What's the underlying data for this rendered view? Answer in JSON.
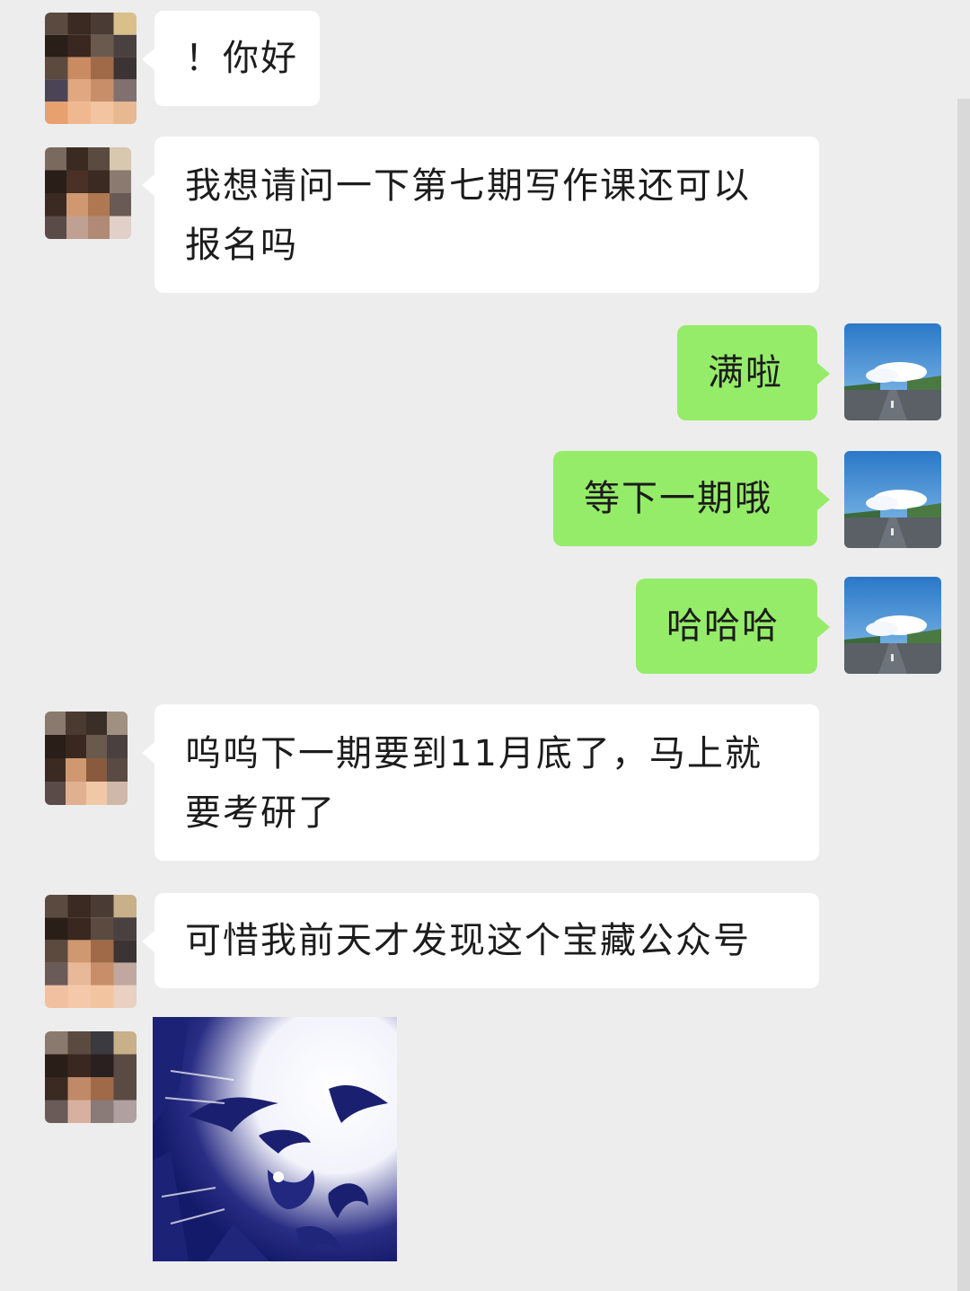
{
  "conversation": {
    "messages": [
      {
        "side": "left",
        "lines": [
          "！你好"
        ]
      },
      {
        "side": "left",
        "lines": [
          "我想请问一下第七期写作课还可以",
          "报名吗"
        ]
      },
      {
        "side": "right",
        "lines": [
          "满啦"
        ]
      },
      {
        "side": "right",
        "lines": [
          "等下一期哦"
        ]
      },
      {
        "side": "right",
        "lines": [
          "哈哈哈"
        ]
      },
      {
        "side": "left",
        "lines": [
          "呜呜下一期要到11月底了，马上就",
          "要考研了"
        ]
      },
      {
        "side": "left",
        "lines": [
          "可惜我前天才发现这个宝藏公众号"
        ]
      }
    ],
    "last_message": {
      "side": "left",
      "type": "sticker",
      "icon": "meme-face-sticker-icon"
    }
  },
  "avatars": {
    "contact": {
      "icon": "pixelated-contact-avatar-icon"
    },
    "self": {
      "icon": "sky-road-avatar-icon"
    }
  },
  "colors": {
    "background": "#ededed",
    "incoming_bubble": "#ffffff",
    "outgoing_bubble": "#95ec69",
    "text": "#1c1c1c"
  }
}
